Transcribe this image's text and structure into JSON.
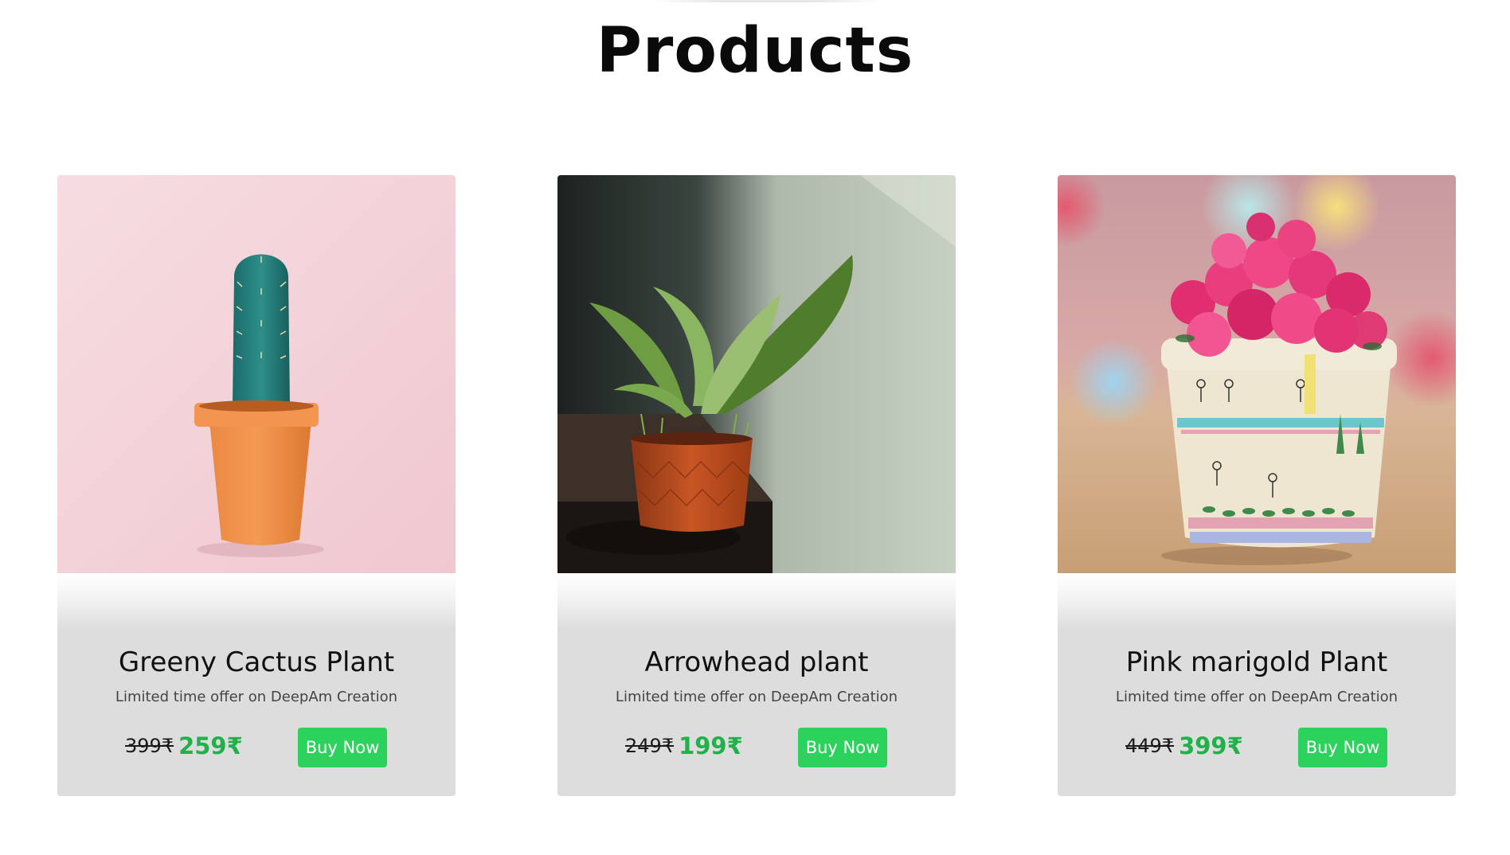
{
  "page": {
    "title": "Products"
  },
  "products": [
    {
      "name": "Greeny Cactus Plant",
      "subtitle": "Limited time offer on DeepAm Creation",
      "old_price": "399₹",
      "new_price": "259₹",
      "button_label": "Buy Now",
      "image": "cactus-in-orange-pot"
    },
    {
      "name": "Arrowhead plant",
      "subtitle": "Limited time offer on DeepAm Creation",
      "old_price": "249₹",
      "new_price": "199₹",
      "button_label": "Buy Now",
      "image": "arrowhead-plant-in-terracotta-pot"
    },
    {
      "name": "Pink marigold Plant",
      "subtitle": "Limited time offer on DeepAm Creation",
      "old_price": "449₹",
      "new_price": "399₹",
      "button_label": "Buy Now",
      "image": "pink-flowers-in-painted-pot"
    }
  ],
  "colors": {
    "accent": "#2bd35d",
    "price_green": "#21b04a",
    "card_background": "#dddddd"
  }
}
